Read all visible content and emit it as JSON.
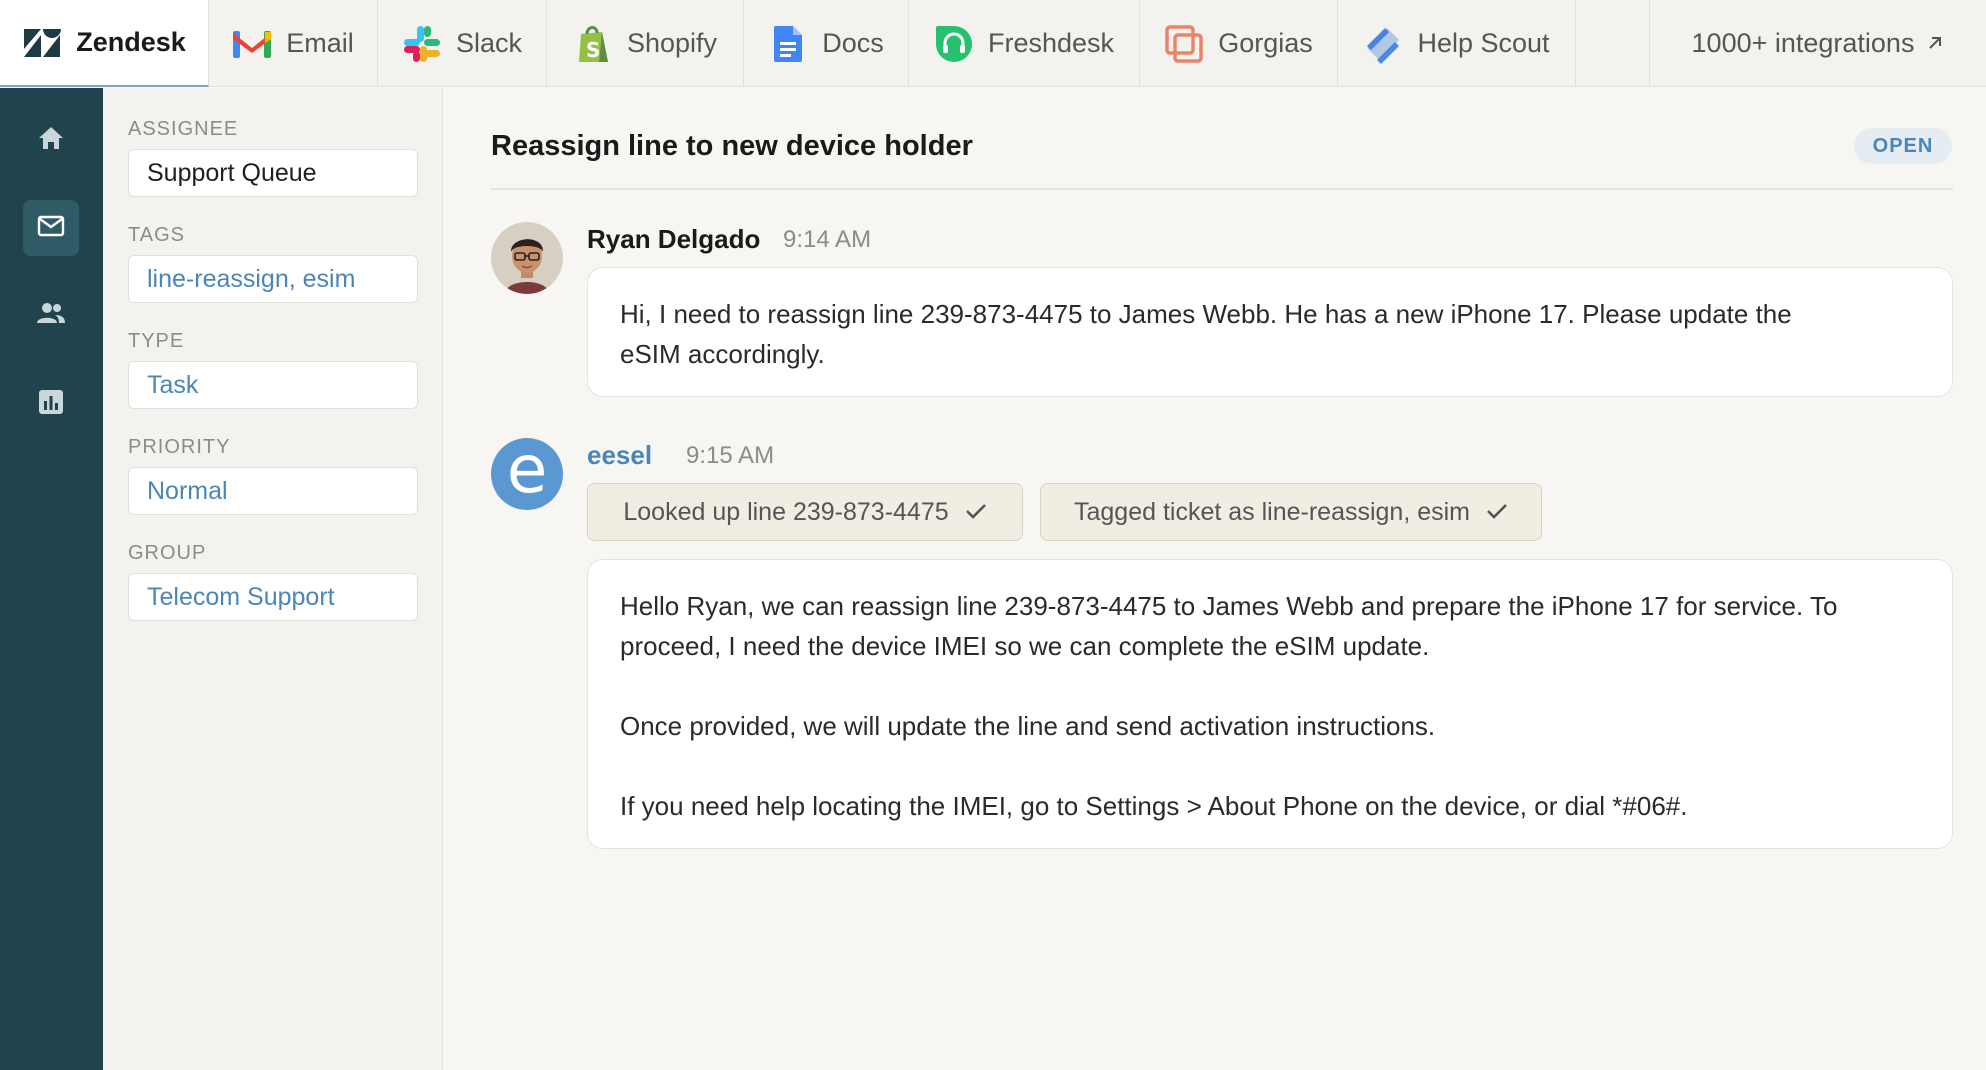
{
  "tabs": [
    {
      "label": "Zendesk",
      "icon": "zendesk-logo-icon",
      "active": true
    },
    {
      "label": "Email",
      "icon": "gmail-icon"
    },
    {
      "label": "Slack",
      "icon": "slack-icon"
    },
    {
      "label": "Shopify",
      "icon": "shopify-icon"
    },
    {
      "label": "Docs",
      "icon": "docs-icon"
    },
    {
      "label": "Freshdesk",
      "icon": "freshdesk-icon"
    },
    {
      "label": "Gorgias",
      "icon": "gorgias-icon"
    },
    {
      "label": "Help Scout",
      "icon": "helpscout-icon"
    }
  ],
  "integrations_link": "1000+ integrations",
  "rail": [
    "home-icon",
    "mail-icon",
    "users-icon",
    "chart-icon"
  ],
  "properties": {
    "assignee": {
      "label": "ASSIGNEE",
      "value": "Support Queue"
    },
    "tags": {
      "label": "TAGS",
      "value": "line-reassign, esim"
    },
    "type": {
      "label": "TYPE",
      "value": "Task"
    },
    "priority": {
      "label": "PRIORITY",
      "value": "Normal"
    },
    "group": {
      "label": "GROUP",
      "value": "Telecom Support"
    }
  },
  "ticket": {
    "title": "Reassign line to new device holder",
    "status": "OPEN"
  },
  "messages": [
    {
      "author": "Ryan Delgado",
      "time": "9:14 AM",
      "lines": [
        "Hi, I need to reassign line 239-873-4475 to James Webb. He has a new iPhone 17. Please update the",
        "eSIM accordingly."
      ]
    },
    {
      "author": "eesel",
      "avatar_letter": "e",
      "time": "9:15 AM",
      "actions": [
        "Looked up line 239-873-4475",
        "Tagged ticket as line-reassign, esim"
      ],
      "lines": [
        "Hello Ryan, we can reassign line 239-873-4475 to James Webb and prepare the iPhone 17 for service. To",
        "proceed, I need the device IMEI so we can complete the eSIM update.",
        "Once provided, we will update the line and send activation instructions.",
        "If you need help locating the IMEI, go to Settings > About Phone on the device, or dial *#06#."
      ]
    }
  ],
  "colors": {
    "rail": "#20434d",
    "link": "#4a86b8",
    "eesel_avatar": "#5b97d1"
  }
}
